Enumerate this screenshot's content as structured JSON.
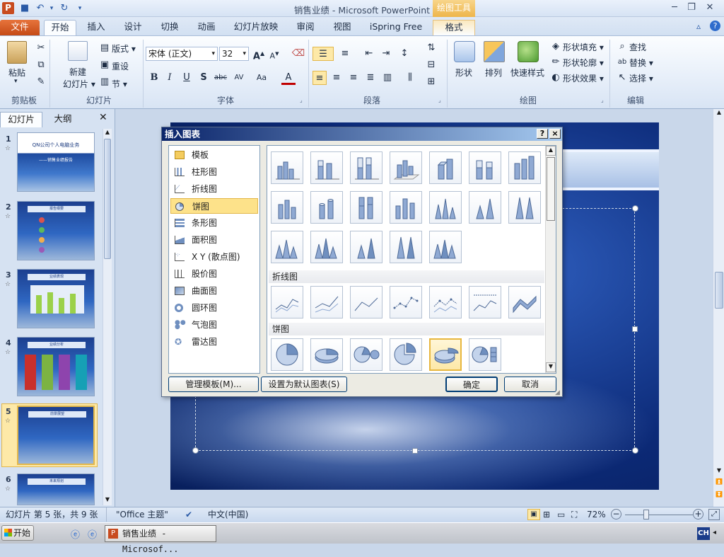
{
  "window": {
    "title": "销售业绩 - Microsoft PowerPoint",
    "context_tab_group": "绘图工具"
  },
  "tabs": [
    "文件",
    "开始",
    "插入",
    "设计",
    "切换",
    "动画",
    "幻灯片放映",
    "审阅",
    "视图",
    "iSpring Free",
    "格式"
  ],
  "ribbon": {
    "clipboard": {
      "paste": "粘贴",
      "label": "剪贴板"
    },
    "slides": {
      "new_slide_1": "新建",
      "new_slide_2": "幻灯片 ▾",
      "layout": "版式 ▾",
      "reset": "重设",
      "section": "节 ▾",
      "label": "幻灯片"
    },
    "font": {
      "font_name": "宋体 (正文)",
      "font_size": "32",
      "label": "字体"
    },
    "paragraph": {
      "label": "段落"
    },
    "drawing": {
      "shape": "形状",
      "arrange": "排列",
      "quick_style": "快速样式",
      "fill": "形状填充 ▾",
      "outline": "形状轮廓 ▾",
      "effect": "形状效果 ▾",
      "label": "绘图"
    },
    "editing": {
      "find": "查找",
      "replace": "替换 ▾",
      "select": "选择 ▾",
      "label": "编辑"
    }
  },
  "panel": {
    "tab_slides": "幻灯片",
    "tab_outline": "大纲",
    "slides": [
      {
        "num": "1",
        "title": "QN公司个人电脑业务",
        "subtitle": "——销售业绩报告"
      },
      {
        "num": "2",
        "title": "报告纲要"
      },
      {
        "num": "3",
        "title": "业绩表现"
      },
      {
        "num": "4",
        "title": "业绩分析"
      },
      {
        "num": "5",
        "title": "前景展望"
      },
      {
        "num": "6",
        "title": "未来规划"
      }
    ]
  },
  "dialog": {
    "title": "插入图表",
    "help": "?",
    "close": "×",
    "categories": [
      "模板",
      "柱形图",
      "折线图",
      "饼图",
      "条形图",
      "面积图",
      "X Y (散点图)",
      "股价图",
      "曲面图",
      "圆环图",
      "气泡图",
      "雷达图"
    ],
    "selected_category": "饼图",
    "section_line": "折线图",
    "section_pie": "饼图",
    "manage_button": "管理模板(M)...",
    "default_button": "设置为默认图表(S)",
    "ok_button": "确定",
    "cancel_button": "取消"
  },
  "status": {
    "slide_info": "幻灯片 第 5 张，共 9 张",
    "theme": "\"Office 主题\"",
    "language": "中文(中国)",
    "zoom": "72%"
  },
  "taskbar": {
    "start": "开始",
    "app": "销售业绩 - Microsof...",
    "ime": "CH"
  }
}
